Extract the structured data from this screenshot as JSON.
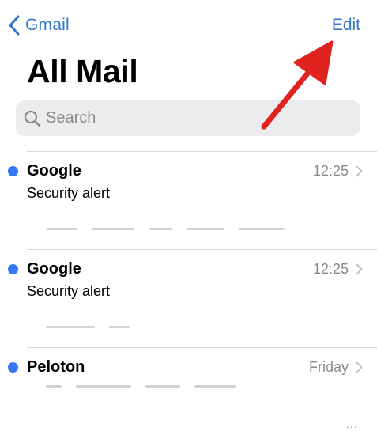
{
  "nav": {
    "back_label": "Gmail",
    "edit_label": "Edit"
  },
  "title": "All Mail",
  "search": {
    "placeholder": "Search",
    "value": ""
  },
  "messages": [
    {
      "sender": "Google",
      "subject": "Security alert",
      "time": "12:25",
      "unread": true
    },
    {
      "sender": "Google",
      "subject": "Security alert",
      "time": "12:25",
      "unread": true
    },
    {
      "sender": "Peloton",
      "subject": "",
      "time": "Friday",
      "unread": true
    }
  ],
  "footer": {
    "more": "..."
  },
  "colors": {
    "accent": "#3478c6",
    "unread_dot": "#3478f6",
    "annotation_arrow": "#e0231f",
    "secondary_text": "#8a8a8e",
    "search_background": "#ececee"
  },
  "icons": {
    "back": "chevron-left-icon",
    "search": "magnifying-glass-icon",
    "row_disclosure": "chevron-right-icon",
    "annotation": "red-arrow-pointing-to-edit"
  }
}
